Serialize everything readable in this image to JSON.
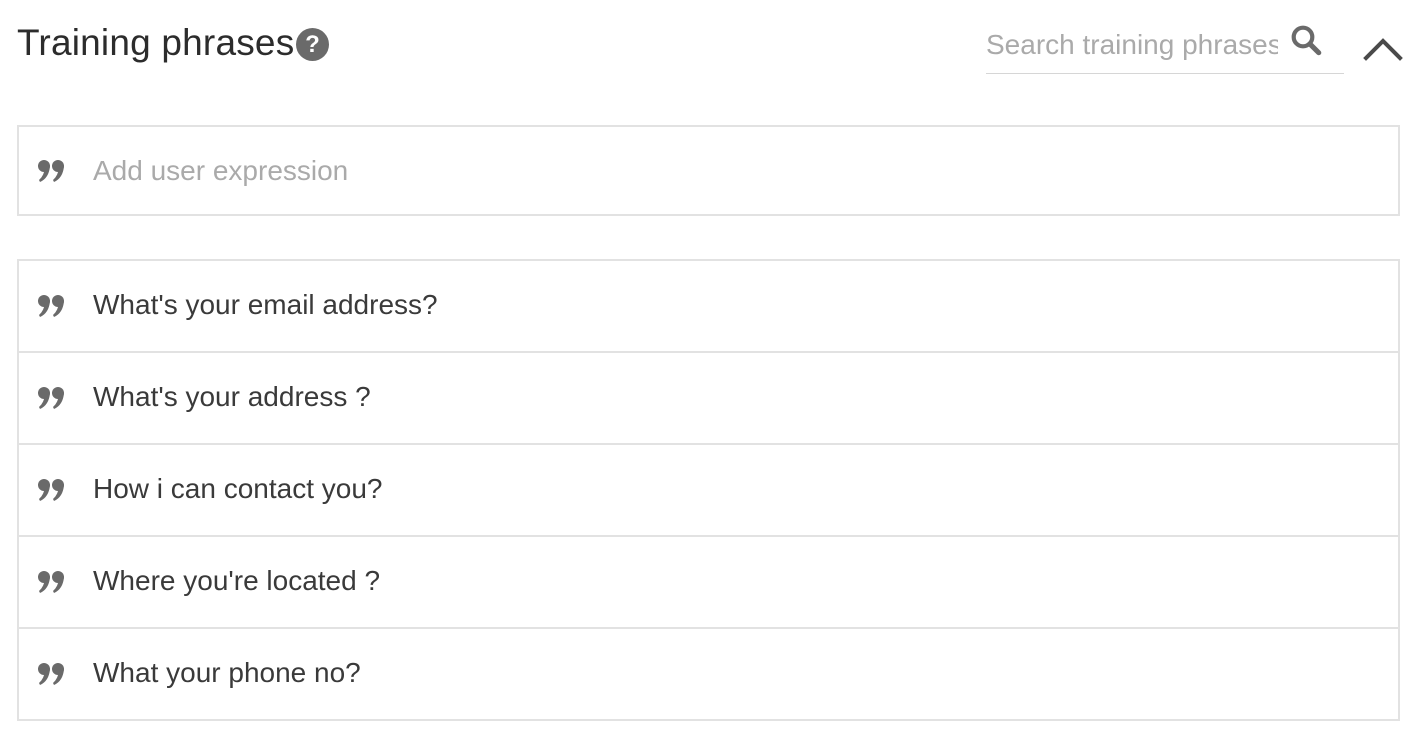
{
  "header": {
    "title": "Training phrases",
    "help_icon": "question-circle-icon",
    "help_glyph": "?",
    "search": {
      "placeholder": "Search training phrases",
      "value": "",
      "icon": "search-icon"
    },
    "collapse_icon": "chevron-up-icon"
  },
  "add_expression": {
    "icon": "quote-icon",
    "placeholder": "Add user expression",
    "value": ""
  },
  "phrases": [
    {
      "icon": "quote-icon",
      "text": "What's your email address?"
    },
    {
      "icon": "quote-icon",
      "text": "What's your address ?"
    },
    {
      "icon": "quote-icon",
      "text": "How i can contact you?"
    },
    {
      "icon": "quote-icon",
      "text": "Where you're located ?"
    },
    {
      "icon": "quote-icon",
      "text": "What your phone no?"
    }
  ],
  "colors": {
    "title_text": "#2c2c2c",
    "icon_gray": "#6a6a6a",
    "placeholder": "#aaaaaa",
    "border": "#e2e2e2",
    "phrase_text": "#3a3a3a"
  }
}
